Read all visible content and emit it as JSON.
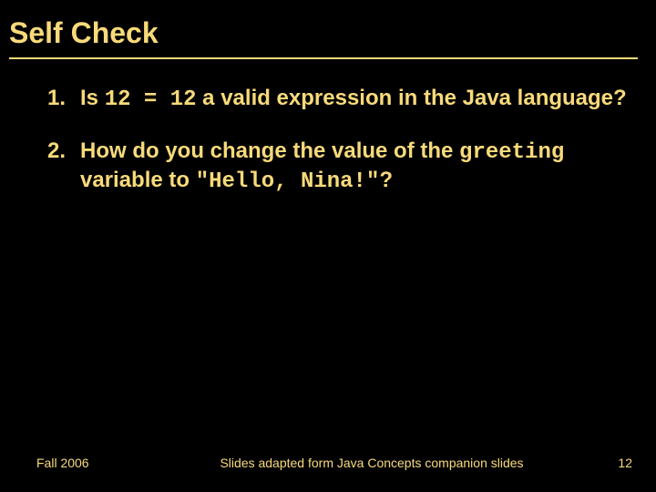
{
  "title": "Self Check",
  "questions": [
    {
      "pre": "Is ",
      "code": "12 = 12",
      "post": " a valid expression in the Java language?"
    },
    {
      "pre": "How do you change the value of the ",
      "code1": "greeting",
      "mid": " variable to ",
      "code2": "\"Hello, Nina!\"",
      "post": "?"
    }
  ],
  "footer": {
    "term": "Fall 2006",
    "center": "Slides adapted form Java Concepts companion slides",
    "page": "12"
  }
}
